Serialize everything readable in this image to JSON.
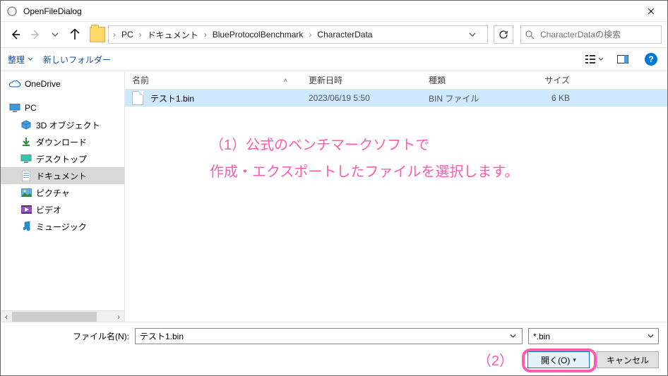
{
  "window": {
    "title": "OpenFileDialog"
  },
  "breadcrumb": {
    "items": [
      "PC",
      "ドキュメント",
      "BlueProtocolBenchmark",
      "CharacterData"
    ]
  },
  "search": {
    "placeholder": "CharacterDataの検索"
  },
  "toolbar": {
    "organize": "整理",
    "new_folder": "新しいフォルダー"
  },
  "columns": {
    "name": "名前",
    "date": "更新日時",
    "type": "種類",
    "size": "サイズ"
  },
  "tree": {
    "onedrive": "OneDrive",
    "pc": "PC",
    "objects3d": "3D オブジェクト",
    "downloads": "ダウンロード",
    "desktop": "デスクトップ",
    "documents": "ドキュメント",
    "pictures": "ピクチャ",
    "videos": "ビデオ",
    "music": "ミュージック"
  },
  "files": [
    {
      "name": "テスト1.bin",
      "date": "2023/06/19 5:50",
      "type": "BIN ファイル",
      "size": "6 KB"
    }
  ],
  "footer": {
    "filename_label": "ファイル名(N):",
    "filename_value": "テスト1.bin",
    "filter": "*.bin",
    "open": "開く(O)",
    "cancel": "キャンセル"
  },
  "annotations": {
    "line1": "（1）公式のベンチマークソフトで",
    "line2": "作成・エクスポートしたファイルを選択します。",
    "step2": "（2）"
  }
}
